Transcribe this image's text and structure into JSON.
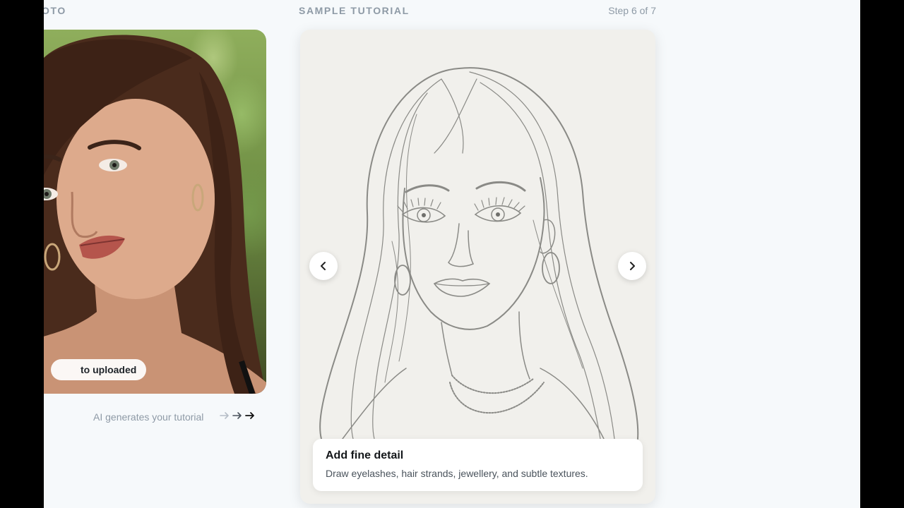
{
  "left_panel": {
    "label": "oto",
    "badge": "to uploaded",
    "caption": "AI generates your tutorial"
  },
  "tutorial": {
    "label": "Sample Tutorial",
    "step_counter": "Step 6 of 7",
    "step_title": "Add fine detail",
    "step_description": "Draw eyelashes, hair strands, jewellery, and subtle textures."
  },
  "icons": {
    "prev": "chevron-left-icon",
    "next": "chevron-right-icon",
    "flow": "arrow-right-icon"
  },
  "colors": {
    "background": "#f6f9fb",
    "muted_text": "#8e9aa6",
    "card": "#f1f0ec"
  }
}
